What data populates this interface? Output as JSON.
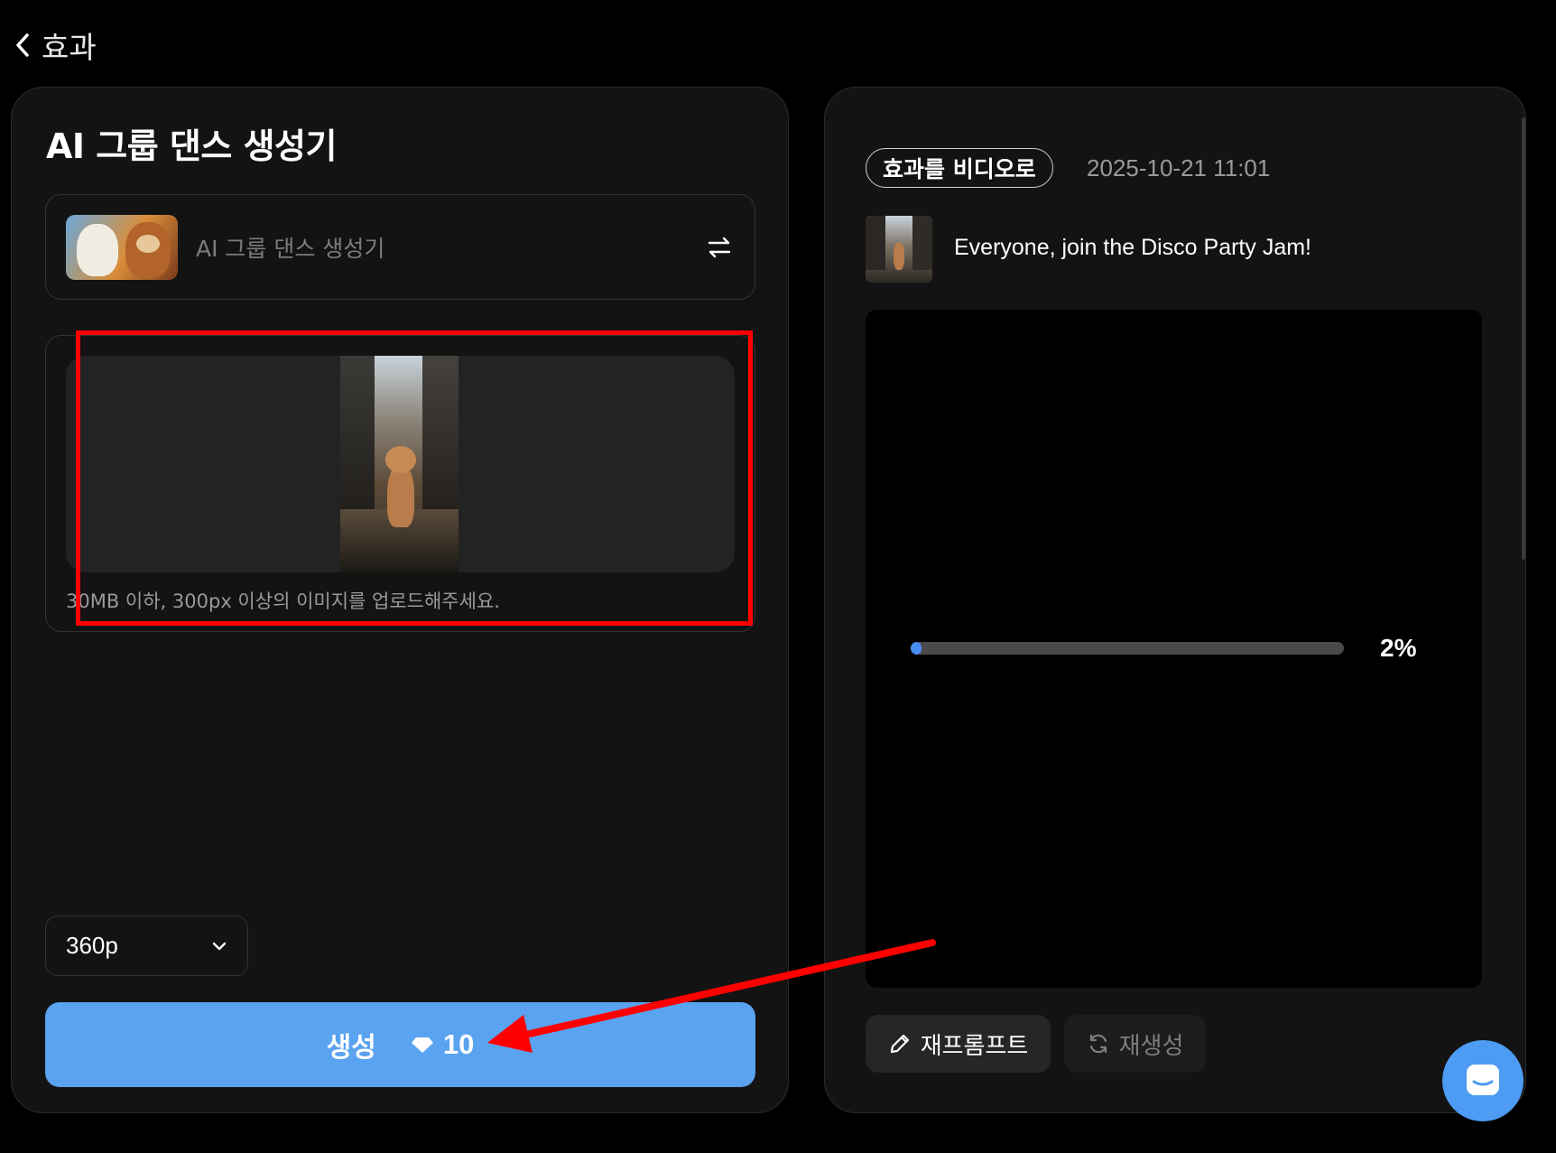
{
  "nav": {
    "back_label": "효과"
  },
  "left": {
    "title": "AI 그룹 댄스 생성기",
    "effect": {
      "name": "AI 그룹 댄스 생성기"
    },
    "upload": {
      "hint": "30MB 이하, 300px 이상의 이미지를 업로드해주세요."
    },
    "resolution": {
      "value": "360p"
    },
    "generate": {
      "label": "생성",
      "cost": "10"
    }
  },
  "right": {
    "type_badge": "효과를 비디오로",
    "timestamp": "2025-10-21 11:01",
    "prompt": "Everyone, join the Disco Party Jam!",
    "progress": {
      "value": 0.02,
      "label": "2%"
    },
    "actions": {
      "reprompt": "재프롬프트",
      "regenerate": "재생성"
    }
  },
  "colors": {
    "background": "#000000",
    "panel": "#131313",
    "accent": "#5aa3f0",
    "progress_fill": "#4b8df7",
    "annotation": "#ff0000"
  },
  "icons": [
    "chevron-left-icon",
    "swap-icon",
    "chevron-down-icon",
    "diamond-icon",
    "pencil-icon",
    "refresh-icon",
    "chat-icon"
  ]
}
